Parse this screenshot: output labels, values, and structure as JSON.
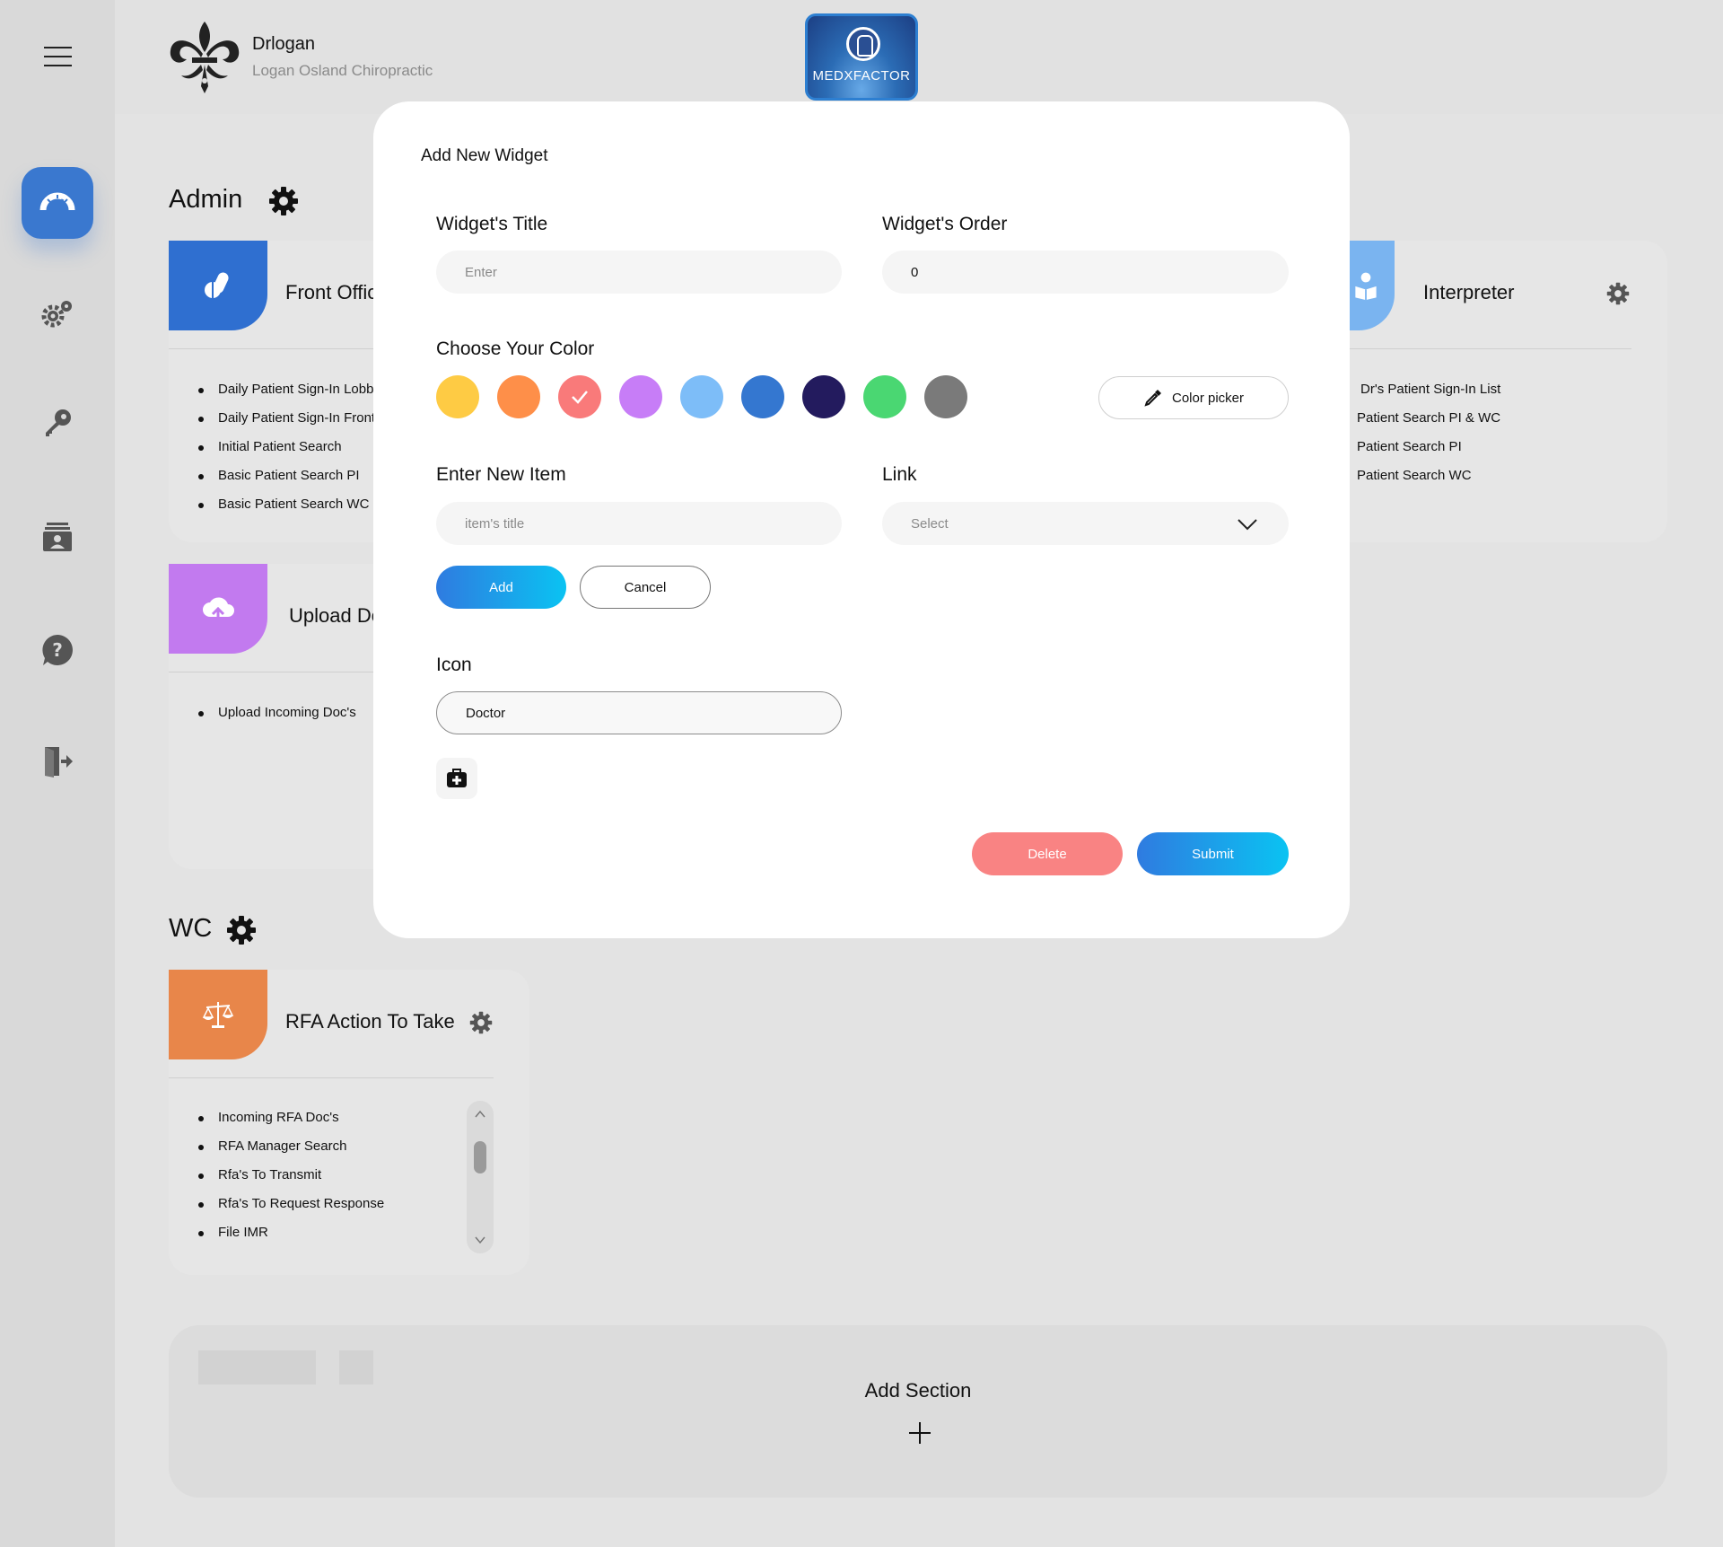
{
  "header": {
    "user_name": "Drlogan",
    "clinic_name": "Logan Osland Chiropractic",
    "brand_text": "MEDXFACTOR"
  },
  "sidebar": {
    "items": [
      {
        "icon": "dashboard-gauge-icon",
        "active": true
      },
      {
        "icon": "settings-gears-icon",
        "active": false
      },
      {
        "icon": "key-icon",
        "active": false
      },
      {
        "icon": "contacts-card-icon",
        "active": false
      },
      {
        "icon": "help-icon",
        "active": false
      },
      {
        "icon": "logout-door-icon",
        "active": false
      }
    ]
  },
  "sections": {
    "admin": {
      "title": "Admin",
      "widgets": {
        "front_office": {
          "title": "Front Office",
          "color": "#2f6fd0",
          "items": [
            "Daily Patient Sign-In Lobby",
            "Daily Patient Sign-In Front Office",
            "Initial Patient Search",
            "Basic Patient Search PI",
            "Basic Patient Search WC"
          ]
        },
        "upload_docs": {
          "title": "Upload Docs",
          "color": "#c27aef",
          "items": [
            "Upload Incoming Doc's"
          ]
        },
        "interpreter": {
          "title": "Interpreter",
          "color": "#7ab4f0",
          "items": [
            "Dr's Patient Sign-In List",
            "Patient Search PI & WC",
            "Patient Search PI",
            "Patient Search WC"
          ]
        }
      }
    },
    "wc": {
      "title": "WC",
      "widgets": {
        "rfa": {
          "title": "RFA Action To Take",
          "color": "#e8864a",
          "items": [
            "Incoming RFA Doc's",
            "RFA Manager Search",
            "Rfa's To Transmit",
            "Rfa's To Request Response",
            "File IMR"
          ]
        }
      }
    }
  },
  "add_section": {
    "label": "Add Section"
  },
  "modal": {
    "heading": "Add New Widget",
    "title_label": "Widget's Title",
    "title_placeholder": "Enter",
    "order_label": "Widget's Order",
    "order_value": "0",
    "color_label": "Choose Your Color",
    "colors": [
      "#fecb44",
      "#fe8f49",
      "#f97a7a",
      "#c77df7",
      "#7dbdf8",
      "#3477d0",
      "#231b5e",
      "#4ad772",
      "#7a7a7a"
    ],
    "selected_color_index": 2,
    "color_picker_label": "Color picker",
    "new_item_label": "Enter New Item",
    "new_item_placeholder": "item's title",
    "link_label": "Link",
    "link_selected": "Select",
    "add_label": "Add",
    "cancel_label": "Cancel",
    "icon_label": "Icon",
    "icon_value": "Doctor",
    "icon_preview": "medical-bag-icon",
    "delete_label": "Delete",
    "submit_label": "Submit"
  }
}
